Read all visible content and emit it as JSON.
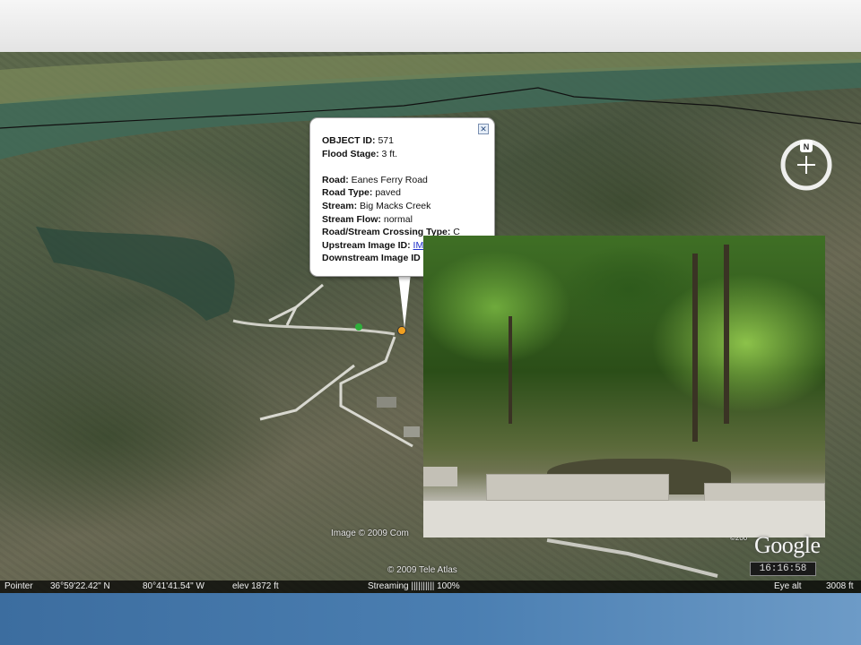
{
  "popup": {
    "object_id_label": "OBJECT ID:",
    "object_id_value": "571",
    "flood_stage_label": "Flood Stage:",
    "flood_stage_value": "3 ft.",
    "road_label": "Road:",
    "road_value": "Eanes Ferry Road",
    "road_type_label": "Road Type:",
    "road_type_value": "paved",
    "stream_label": "Stream:",
    "stream_value": "Big Macks Creek",
    "stream_flow_label": "Stream Flow:",
    "stream_flow_value": "normal",
    "crossing_type_label": "Road/Stream Crossing Type:",
    "crossing_type_value": "C",
    "upstream_label": "Upstream Image ID:",
    "upstream_link": "IM",
    "downstream_label": "Downstream Image ID",
    "close_glyph": "✕"
  },
  "overlays": {
    "image_credit": "Image © 2009 Com",
    "tele_atlas": "© 2009 Tele Atlas",
    "year_fragment": "©200",
    "google_logo": "Google",
    "clock": "16:16:58"
  },
  "statusbar": {
    "pointer": "Pointer",
    "lat": "36°59'22.42\" N",
    "lon": "80°41'41.54\" W",
    "elev": "elev  1872 ft",
    "streaming": "Streaming  ||||||||||  100%",
    "eye_alt": "Eye alt",
    "eye_alt_value": "3008 ft"
  },
  "colors": {
    "accent_blue": "#4b7fb2",
    "popup_link": "#1d2fc9"
  },
  "icons": [
    "close-icon",
    "compass-icon",
    "placemark-icon"
  ]
}
